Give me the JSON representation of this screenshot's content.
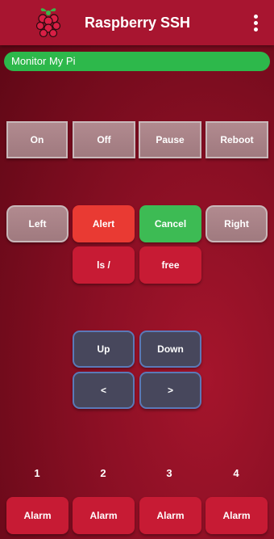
{
  "app": {
    "title": "Raspberry SSH",
    "logo_icon": "raspberry-logo-icon",
    "menu_icon": "more-vertical-icon"
  },
  "status": {
    "text": "Monitor My Pi",
    "color": "#2db84b"
  },
  "power": {
    "on": "On",
    "off": "Off",
    "pause": "Pause",
    "reboot": "Reboot"
  },
  "controls": {
    "left": "Left",
    "alert": "Alert",
    "cancel": "Cancel",
    "right": "Right",
    "ls": "ls /",
    "free": "free"
  },
  "nav": {
    "up": "Up",
    "down": "Down",
    "prev": "<",
    "next": ">"
  },
  "alarms": [
    {
      "number": "1",
      "label": "Alarm"
    },
    {
      "number": "2",
      "label": "Alarm"
    },
    {
      "number": "3",
      "label": "Alarm"
    },
    {
      "number": "4",
      "label": "Alarm"
    }
  ],
  "colors": {
    "accent": "#a81530",
    "green": "#3dbb54",
    "orange": "#e93a33",
    "red_button": "#c71b34",
    "navy_button": "#47475c"
  }
}
